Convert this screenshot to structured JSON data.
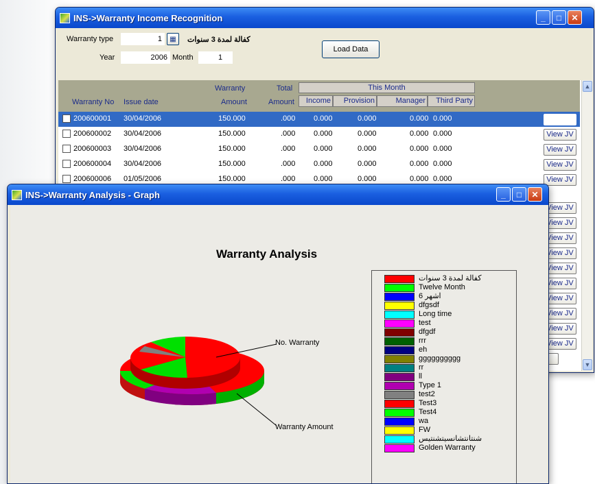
{
  "back_window": {
    "title": "INS->Warranty Income Recognition",
    "form": {
      "warranty_type_label": "Warranty type",
      "warranty_type_value": "1",
      "warranty_type_name": "كفالة لمدة 3 سنوات",
      "year_label": "Year",
      "year_value": "2006",
      "month_label": "Month",
      "month_value": "1",
      "load_button": "Load Data"
    },
    "grid": {
      "headers": {
        "warranty_no": "Warranty No",
        "issue_date": "Issue date",
        "warranty_top": "Warranty",
        "warranty_bottom": "Amount",
        "total_top": "Total",
        "total_bottom": "Amount",
        "this_month": "This Month",
        "income": "Income",
        "provision": "Provision",
        "manager": "Manager",
        "third_party": "Third Party"
      },
      "rows": [
        {
          "no": "200600001",
          "date": "30/04/2006",
          "amount": "150.000",
          "total": ".000",
          "income": "0.000",
          "provision": "0.000",
          "manager": "0.000",
          "third": "0.000",
          "selected": true
        },
        {
          "no": "200600002",
          "date": "30/04/2006",
          "amount": "150.000",
          "total": ".000",
          "income": "0.000",
          "provision": "0.000",
          "manager": "0.000",
          "third": "0.000"
        },
        {
          "no": "200600003",
          "date": "30/04/2006",
          "amount": "150.000",
          "total": ".000",
          "income": "0.000",
          "provision": "0.000",
          "manager": "0.000",
          "third": "0.000"
        },
        {
          "no": "200600004",
          "date": "30/04/2006",
          "amount": "150.000",
          "total": ".000",
          "income": "0.000",
          "provision": "0.000",
          "manager": "0.000",
          "third": "0.000"
        },
        {
          "no": "200600006",
          "date": "01/05/2006",
          "amount": "150.000",
          "total": ".000",
          "income": "0.000",
          "provision": "0.000",
          "manager": "0.000",
          "third": "0.000"
        }
      ],
      "view_jv_label": "View JV"
    }
  },
  "front_window": {
    "title": "INS->Warranty Analysis - Graph"
  },
  "chart_data": {
    "type": "pie",
    "title": "Warranty Analysis",
    "annotations": [
      "No. Warranty",
      "Warranty Amount"
    ],
    "legend_position": "right",
    "legend": [
      {
        "label": "كفالة لمدة 3 سنوات",
        "color": "#ff0000"
      },
      {
        "label": "Twelve Month",
        "color": "#00ff00"
      },
      {
        "label": "6 اشهر",
        "color": "#0000ff"
      },
      {
        "label": "dfgsdf",
        "color": "#ffff00"
      },
      {
        "label": "Long time",
        "color": "#00ffff"
      },
      {
        "label": "test",
        "color": "#ff00ff"
      },
      {
        "label": "dfgdf",
        "color": "#800000"
      },
      {
        "label": "rrr",
        "color": "#006000"
      },
      {
        "label": "eh",
        "color": "#000080"
      },
      {
        "label": "gggggggggg",
        "color": "#808000"
      },
      {
        "label": "rr",
        "color": "#008080"
      },
      {
        "label": "ll",
        "color": "#800080"
      },
      {
        "label": "Type 1",
        "color": "#b000b0"
      },
      {
        "label": "test2",
        "color": "#808080"
      },
      {
        "label": "Test3",
        "color": "#ff0000"
      },
      {
        "label": "Test4",
        "color": "#00ff00"
      },
      {
        "label": "wa",
        "color": "#0000ff"
      },
      {
        "label": "FW",
        "color": "#ffff00"
      },
      {
        "label": "شنتانتشانسيتشنتيس",
        "color": "#00ffff"
      },
      {
        "label": "Golden Warranty",
        "color": "#ff00ff"
      }
    ]
  }
}
